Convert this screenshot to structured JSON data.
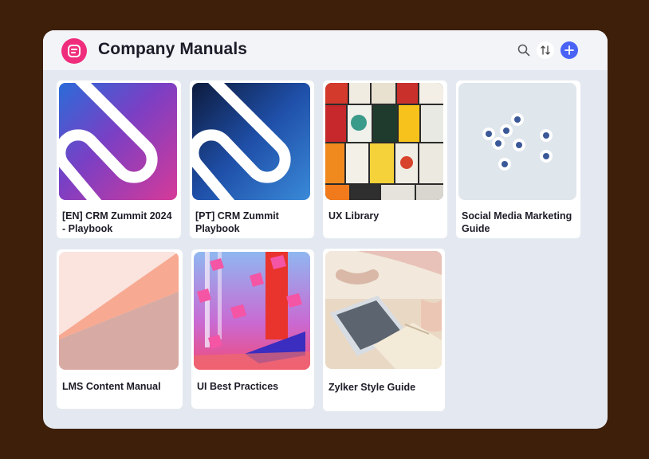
{
  "header": {
    "title": "Company Manuals",
    "icons": [
      "search-icon",
      "sort-icon",
      "add-icon"
    ]
  },
  "colors": {
    "brand": "#ef2d7c",
    "accent": "#4a63f5",
    "background": "#e4e9f1"
  },
  "manuals": [
    {
      "title": "[EN] CRM Zummit 2024 - Playbook"
    },
    {
      "title": "[PT] CRM Zummit Playbook"
    },
    {
      "title": "UX Library"
    },
    {
      "title": "Social Media Marketing Guide"
    },
    {
      "title": "LMS Content Manual"
    },
    {
      "title": "UI Best Practices"
    },
    {
      "title": "Zylker Style Guide"
    }
  ]
}
